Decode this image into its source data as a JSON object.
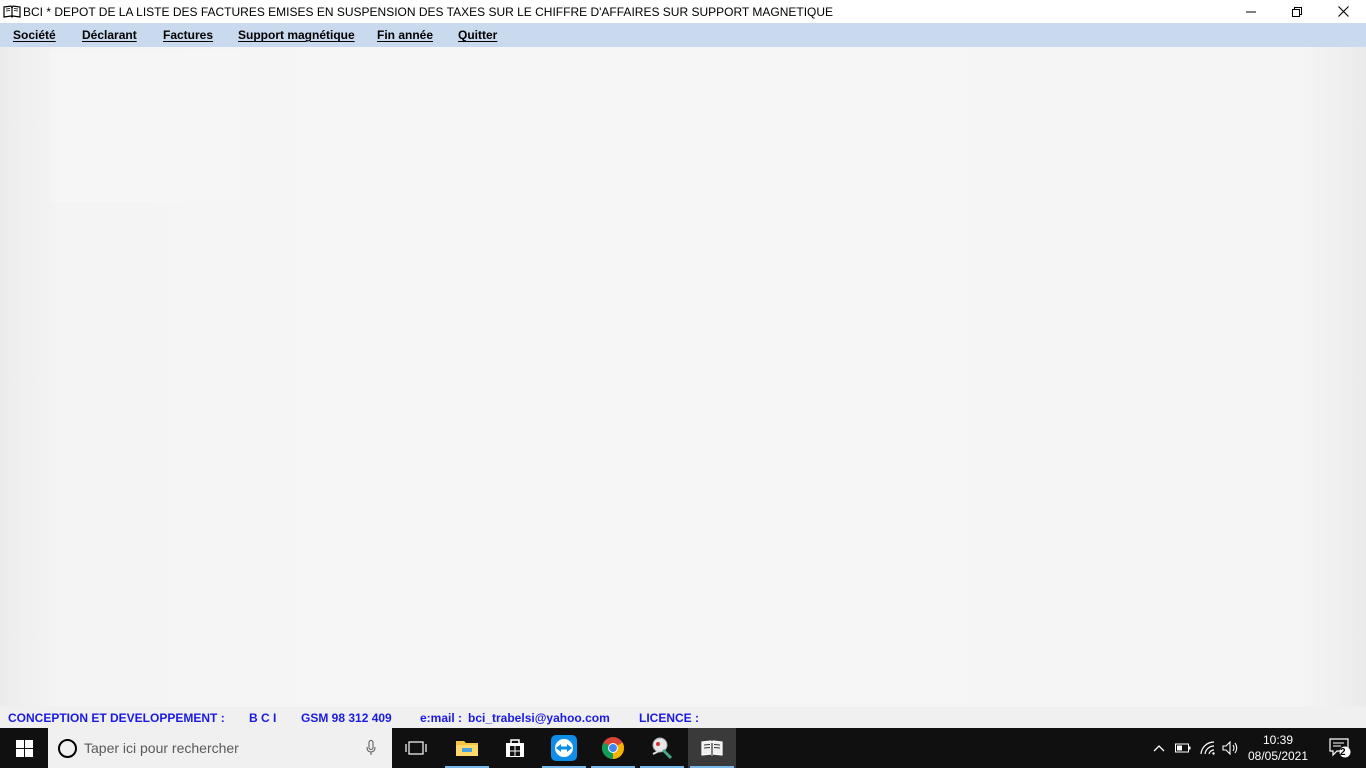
{
  "window": {
    "title": "BCI *   DEPOT DE LA LISTE DES FACTURES EMISES EN SUSPENSION DES TAXES SUR LE CHIFFRE D'AFFAIRES SUR SUPPORT MAGNETIQUE"
  },
  "menu": {
    "items": [
      "Société",
      "Déclarant",
      "Factures",
      "Support magnétique",
      "Fin année",
      "Quitter"
    ]
  },
  "status": {
    "conception": "CONCEPTION ET DEVELOPPEMENT :",
    "company": "B C I",
    "gsm": "GSM 98 312 409",
    "email_label": "e:mail :",
    "email": "bci_trabelsi@yahoo.com",
    "licence": "LICENCE :"
  },
  "taskbar": {
    "search_placeholder": "Taper ici pour rechercher",
    "time": "10:39",
    "date": "08/05/2021",
    "notification_count": "2"
  },
  "colors": {
    "menubar": "#c9d9ee",
    "status_text": "#1a1ae6",
    "taskbar": "#101010",
    "accent": "#76b9ed"
  }
}
